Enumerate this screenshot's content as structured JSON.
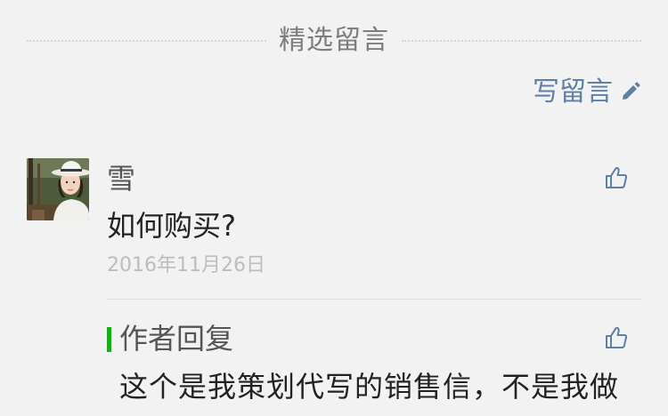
{
  "section": {
    "title": "精选留言"
  },
  "write_comment": {
    "label": "写留言",
    "icon": "pencil-icon"
  },
  "comment": {
    "author": "雪",
    "text": "如何购买?",
    "date": "2016年11月26日",
    "like_icon": "thumbs-up-icon",
    "avatar": "avatar-photo"
  },
  "reply": {
    "title": "作者回复",
    "text": "这个是我策划代写的销售信，不是我做",
    "like_icon": "thumbs-up-icon"
  },
  "colors": {
    "background": "#f2f2f2",
    "link": "#607fa6",
    "reply_bar": "#1aad19",
    "date": "#bcbcbc"
  }
}
